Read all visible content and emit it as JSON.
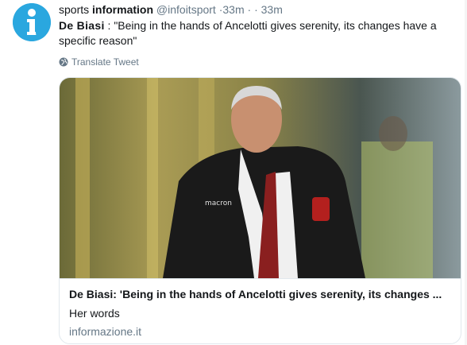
{
  "tweet": {
    "author_name_part1": "sports",
    "author_name_part2": "information",
    "handle": "@infoitsport",
    "time_separator": "·",
    "time": "33m",
    "extra_time": "· · 33m",
    "text_bold": "De  Biasi",
    "text_rest": " : \"Being in the hands of Ancelotti gives serenity, its changes have a specific reason\"",
    "translate_label": "Translate Tweet"
  },
  "card": {
    "title": "De Biasi: 'Being in the hands of Ancelotti gives serenity, its changes ...",
    "description": "Her words",
    "domain": "informazione.it",
    "image_logo_text": "macron"
  },
  "icons": {
    "avatar": "info-i-logo",
    "translate": "globe-icon"
  },
  "colors": {
    "avatar_blue": "#2aa7df",
    "secondary_text": "#657786",
    "border": "#e1e8ed"
  }
}
